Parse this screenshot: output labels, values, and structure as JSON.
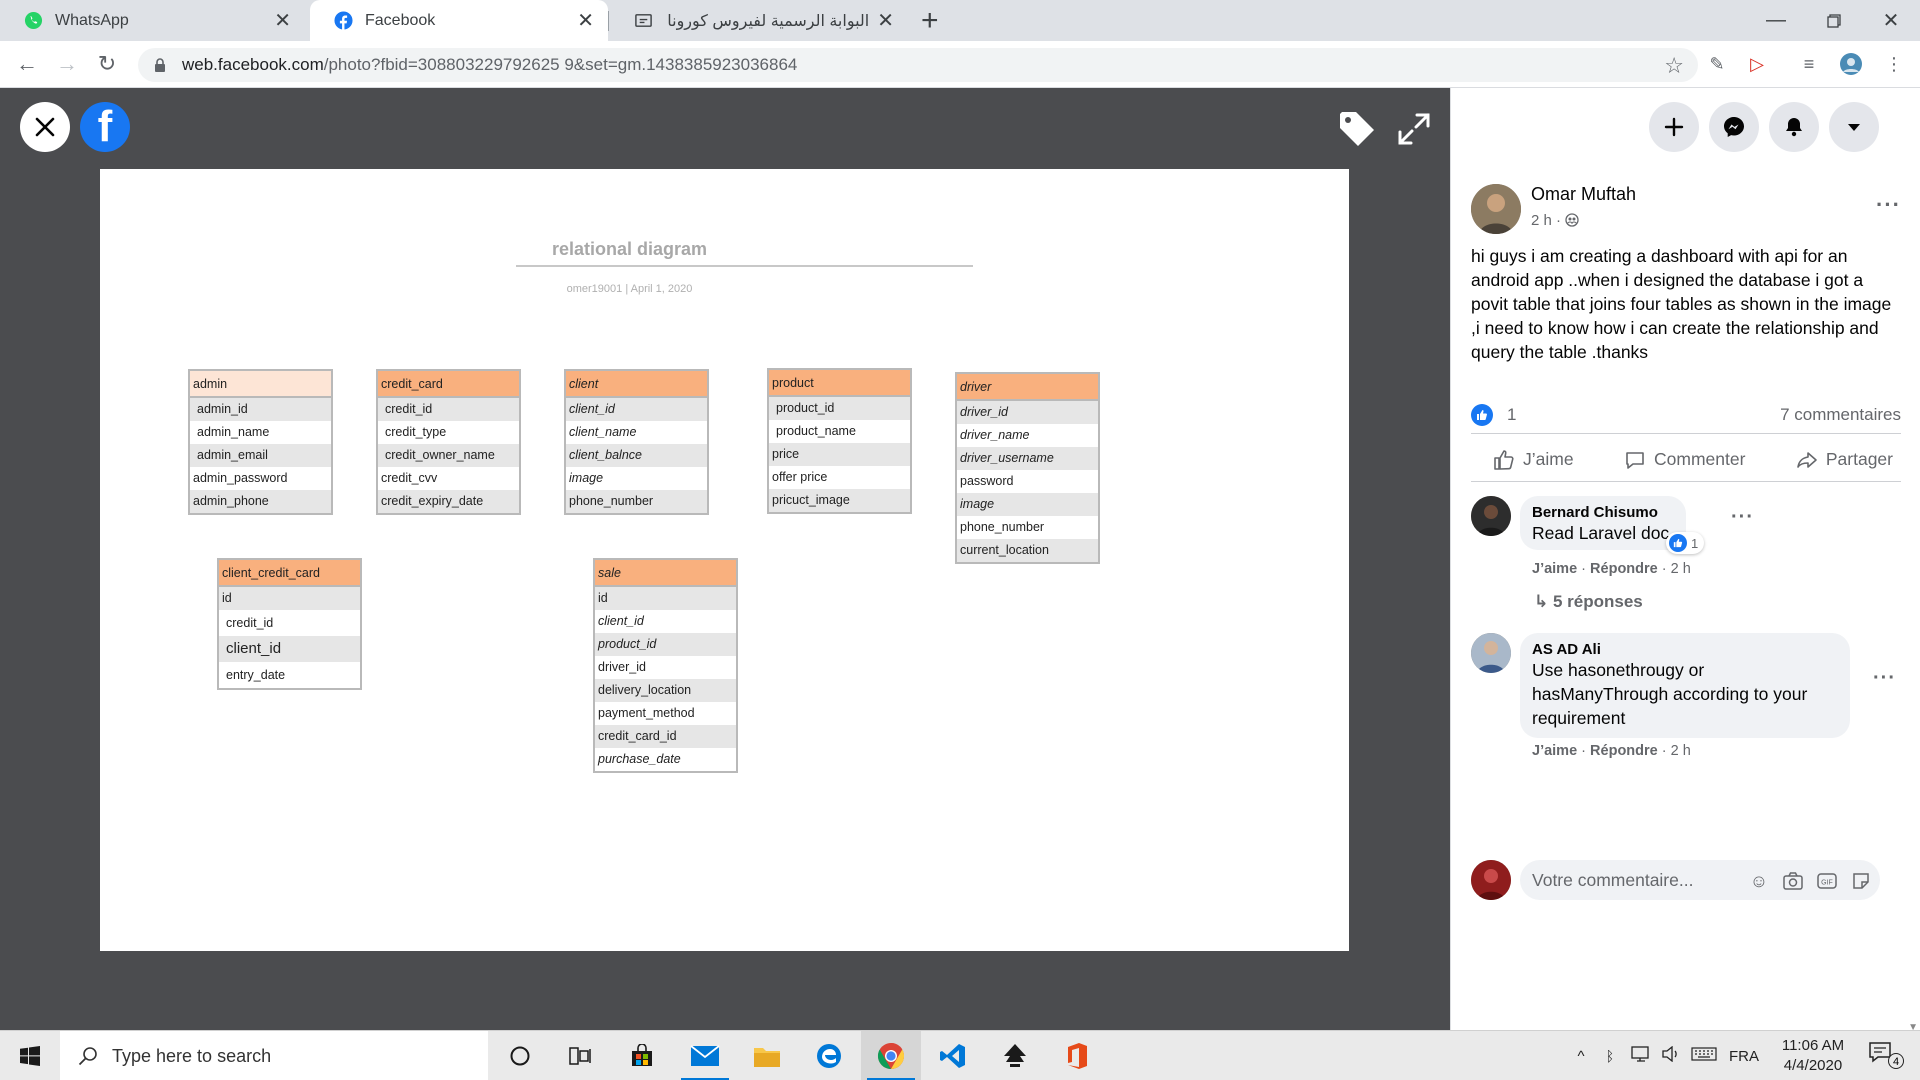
{
  "tabs": [
    {
      "title": "WhatsApp"
    },
    {
      "title": "Facebook"
    },
    {
      "title": "البوابة الرسمية لفيروس كورونا بالمملكة"
    }
  ],
  "url": {
    "host": "web.facebook.com",
    "path": "/photo?fbid=308803229792625 9&set=gm.1438385923036864"
  },
  "diagram": {
    "title": "relational diagram",
    "subtitle": "omer19001   |   April 1, 2020",
    "tables": {
      "admin": {
        "name": "admin",
        "rows": [
          "admin_id",
          "admin_name",
          "admin_email",
          "admin_password",
          "admin_phone"
        ]
      },
      "credit_card": {
        "name": "credit_card",
        "rows": [
          "credit_id",
          "credit_type",
          "credit_owner_name",
          "credit_cvv",
          "credit_expiry_date"
        ]
      },
      "client": {
        "name": "client",
        "rows": [
          "client_id",
          "client_name",
          "client_balnce",
          "image",
          "phone_number"
        ]
      },
      "product": {
        "name": "product",
        "rows": [
          "product_id",
          "product_name",
          "price",
          "offer price",
          "pricuct_image"
        ]
      },
      "driver": {
        "name": "driver",
        "rows": [
          "driver_id",
          "driver_name",
          "driver_username",
          "password",
          "image",
          "phone_number",
          "current_location"
        ]
      },
      "client_credit_card": {
        "name": "client_credit_card",
        "rows": [
          "id",
          "credit_id",
          "client_id",
          "entry_date"
        ]
      },
      "sale": {
        "name": "sale",
        "rows": [
          "id",
          "client_id",
          "product_id",
          "driver_id",
          "delivery_location",
          "payment_method",
          "credit_card_id",
          "purchase_date"
        ]
      }
    }
  },
  "post": {
    "author": "Omar Muftah",
    "time": "2 h ·",
    "text": "hi guys i am creating a dashboard with api for an android app ..when i designed the database i got a povit table that joins four tables as shown in the image ,i need to know how i can create the relationship and query the table .thanks",
    "like_count": "1",
    "comment_count": "7 commentaires",
    "actions": {
      "like": "J’aime",
      "comment": "Commenter",
      "share": "Partager"
    }
  },
  "comments": [
    {
      "name": "Bernard Chisumo",
      "text": "Read Laravel doc",
      "reaction_count": "1",
      "like": "J’aime",
      "reply": "Répondre",
      "time": "2 h",
      "replies": "5 réponses"
    },
    {
      "name": "AS AD Ali",
      "text": "Use hasonethrougy or hasManyThrough according to your requirement",
      "like": "J’aime",
      "reply": "Répondre",
      "time": "2 h"
    }
  ],
  "composer": {
    "placeholder": "Votre commentaire..."
  },
  "taskbar": {
    "search_placeholder": "Type here to search",
    "language": "FRA",
    "time": "11:06 AM",
    "date": "4/4/2020",
    "notifications": "4"
  },
  "colors": {
    "facebook_blue": "#1877f2",
    "table_header": "#f9b07e",
    "viewer_bg": "#4b4c4f"
  }
}
